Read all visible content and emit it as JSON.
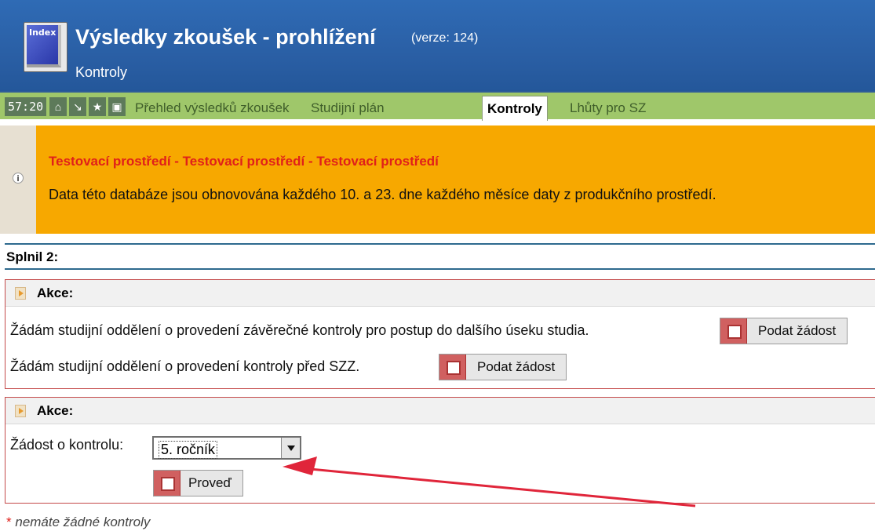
{
  "header": {
    "logo_text": "Index",
    "title": "Výsledky zkoušek - prohlížení",
    "version": "(verze: 124)",
    "subtitle": "Kontroly"
  },
  "navbar": {
    "timer": "57:20",
    "icons": [
      "home-icon",
      "arrow-down-right-icon",
      "star-icon",
      "save-icon"
    ],
    "tabs": [
      {
        "label": "Přehled výsledků zkoušek",
        "active": false
      },
      {
        "label": "Studijní plán",
        "active": false
      },
      {
        "label": "Kontroly",
        "active": true
      },
      {
        "label": "Lhůty pro SZ",
        "active": false
      }
    ]
  },
  "warning": {
    "title": "Testovací prostředí - Testovací prostředí - Testovací prostředí",
    "text": "Data této databáze jsou obnovována každého 10. a 23. dne každého měsíce daty z produkčního prostředí."
  },
  "splnil": {
    "label": "Splnil 2:"
  },
  "action1": {
    "title": "Akce:",
    "rows": [
      {
        "text": "Žádám studijní oddělení o provedení závěrečné kontroly pro postup do dalšího úseku studia.",
        "button": "Podat žádost"
      },
      {
        "text": "Žádám studijní oddělení o provedení kontroly před SZZ.",
        "button": "Podat žádost"
      }
    ]
  },
  "action2": {
    "title": "Akce:",
    "label": "Žádost o kontrolu:",
    "select_value": "5. ročník",
    "button": "Proveď"
  },
  "footer": {
    "note": "nemáte žádné kontroly",
    "star": "*"
  },
  "colors": {
    "header_blue": "#2a5fa5",
    "nav_green": "#9fc76a",
    "warning_orange": "#f7a800",
    "warning_title_red": "#e0201a",
    "annotation_arrow_red": "#e0253a"
  }
}
